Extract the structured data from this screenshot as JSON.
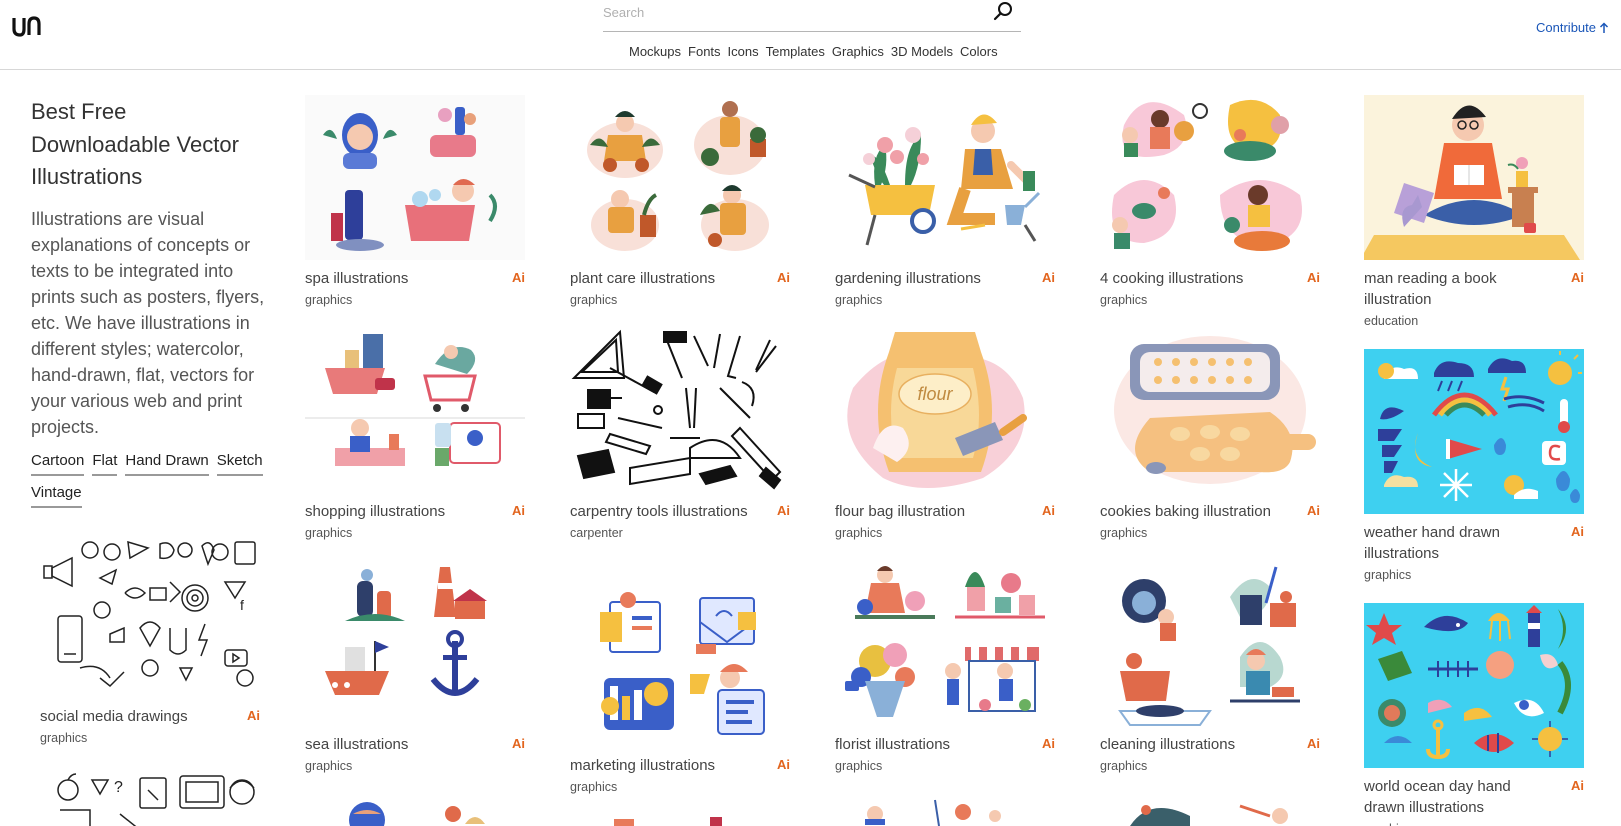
{
  "header": {
    "logo_label": "un",
    "search_placeholder": "Search",
    "nav": [
      "Mockups",
      "Fonts",
      "Icons",
      "Templates",
      "Graphics",
      "3D Models",
      "Colors"
    ],
    "contribute_label": "Contribute",
    "link_color": "#1a56b8"
  },
  "sidebar": {
    "title": "Best Free Downloadable Vector Illustrations",
    "description": "Illustrations are visual explanations of concepts or texts to be integrated into prints such as posters, flyers, etc. We have illustrations in different styles; watercolor, hand-drawn, flat, vectors for your various web and print projects.",
    "tags": [
      "Cartoon",
      "Flat",
      "Hand Drawn",
      "Sketch",
      "Vintage"
    ],
    "cards": [
      {
        "title": "social media drawings",
        "category": "graphics",
        "badge": "Ai"
      }
    ]
  },
  "badge_color": "#e2651e",
  "cards": [
    {
      "title": "spa illustrations",
      "category": "graphics",
      "badge": "Ai"
    },
    {
      "title": "plant care illustrations",
      "category": "graphics",
      "badge": "Ai"
    },
    {
      "title": "gardening illustrations",
      "category": "graphics",
      "badge": "Ai"
    },
    {
      "title": "4 cooking illustrations",
      "category": "graphics",
      "badge": "Ai"
    },
    {
      "title": "man reading a book illustration",
      "category": "education",
      "badge": "Ai"
    },
    {
      "title": "shopping illustrations",
      "category": "graphics",
      "badge": "Ai"
    },
    {
      "title": "carpentry tools illustrations",
      "category": "carpenter",
      "badge": "Ai"
    },
    {
      "title": "flour bag illustration",
      "category": "graphics",
      "badge": "Ai",
      "thumb_text": "flour"
    },
    {
      "title": "cookies baking illustration",
      "category": "graphics",
      "badge": "Ai"
    },
    {
      "title": "weather hand drawn illustrations",
      "category": "graphics",
      "badge": "Ai"
    },
    {
      "title": "sea illustrations",
      "category": "graphics",
      "badge": "Ai"
    },
    {
      "title": "marketing illustrations",
      "category": "graphics",
      "badge": "Ai"
    },
    {
      "title": "florist illustrations",
      "category": "graphics",
      "badge": "Ai"
    },
    {
      "title": "cleaning illustrations",
      "category": "graphics",
      "badge": "Ai"
    },
    {
      "title": "world ocean day hand drawn illustrations",
      "category": "graphics",
      "badge": "Ai"
    }
  ]
}
